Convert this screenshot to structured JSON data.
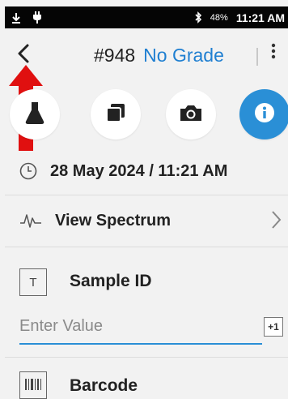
{
  "status_bar": {
    "battery": "48%",
    "time": "11:21 AM",
    "icons": [
      "usb-download-icon",
      "plug-icon",
      "bluetooth-icon"
    ]
  },
  "header": {
    "sample_number": "#948",
    "grade": "No Grade",
    "icons": [
      "back-arrow-icon",
      "more-vert-icon"
    ]
  },
  "tabs": [
    {
      "icon": "flask-icon",
      "active": false
    },
    {
      "icon": "copy-icon",
      "active": false
    },
    {
      "icon": "camera-icon",
      "active": false
    },
    {
      "icon": "info-icon",
      "active": true
    }
  ],
  "timestamp": {
    "icon": "clock-icon",
    "text": "28 May 2024 / 11:21 AM"
  },
  "spectrum": {
    "icon": "waveform-icon",
    "label": "View Spectrum",
    "chevron": "chevron-right-icon"
  },
  "sample_id_field": {
    "type_icon": "T",
    "label": "Sample ID",
    "placeholder": "Enter Value",
    "value": "",
    "increment_label": "+1"
  },
  "barcode_field": {
    "icon": "barcode-icon",
    "label": "Barcode"
  },
  "colors": {
    "accent": "#2a8fd6",
    "title_blue": "#1f7fd1",
    "annotation_red": "#e01010",
    "background": "#f2f2f2"
  }
}
